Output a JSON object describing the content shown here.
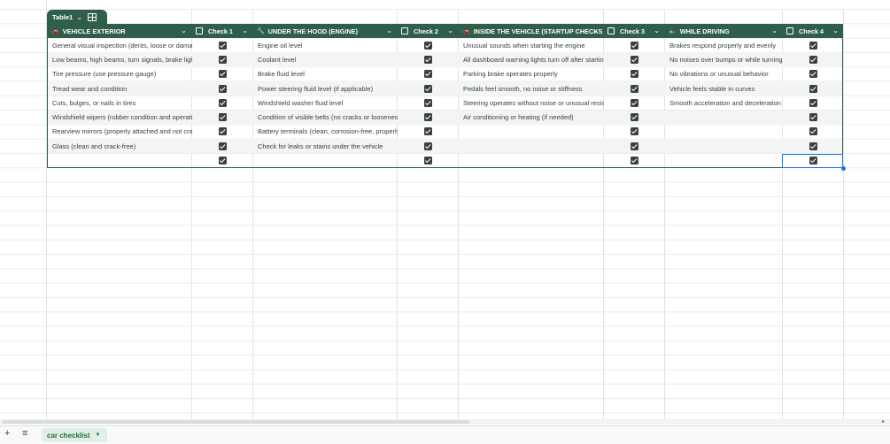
{
  "table": {
    "name": "Table1"
  },
  "columns": [
    {
      "label": "VEHICLE EXTERIOR",
      "icon": "car-icon",
      "icon_glyph": "🚗"
    },
    {
      "label": "Check 1",
      "icon": "checkbox-icon"
    },
    {
      "label": "UNDER THE HOOD (ENGINE)",
      "icon": "wrench-icon",
      "icon_glyph": "🔧"
    },
    {
      "label": "Check 2",
      "icon": "checkbox-icon"
    },
    {
      "label": "INSIDE THE VEHICLE (STARTUP CHECKS",
      "icon": "car-icon",
      "icon_glyph": "🚗"
    },
    {
      "label": "Check 3",
      "icon": "checkbox-icon"
    },
    {
      "label": "WHILE DRIVING",
      "icon": "speaker-icon",
      "icon_glyph": "🔈"
    },
    {
      "label": "Check 4",
      "icon": "checkbox-icon"
    }
  ],
  "rows": [
    {
      "ext": "General visual inspection (dents, loose or damage",
      "hood": "Engine oil level",
      "inside": "Unusual sounds when starting the engine",
      "driving": "Brakes respond properly and evenly"
    },
    {
      "ext": "Low beams, high beams, turn signals, brake lights",
      "hood": "Coolant level",
      "inside": "All dashboard warning lights turn off after starting",
      "driving": "No noises over bumps or while turning"
    },
    {
      "ext": "Tire pressure (use pressure gauge)",
      "hood": "Brake fluid level",
      "inside": "Parking brake operates properly",
      "driving": "No vibrations or unusual behavior"
    },
    {
      "ext": "Tread wear and condition",
      "hood": "Power steering fluid level (if applicable)",
      "inside": "Pedals feel smooth, no noise or stiffness",
      "driving": "Vehicle feels stable in curves"
    },
    {
      "ext": "Cuts, bulges, or nails in tires",
      "hood": "Windshield washer fluid level",
      "inside": "Steering operates without noise or unusual resista",
      "driving": "Smooth acceleration and deceleration"
    },
    {
      "ext": "Windshield wipers (rubber condition and operatio",
      "hood": "Condition of visible belts (no cracks or looseness)",
      "inside": "Air conditioning or heating (if needed)",
      "driving": ""
    },
    {
      "ext": "Rearview mirrors (properly attached and not crack",
      "hood": "Battery terminals (clean, corrosion-free, properly t",
      "inside": "",
      "driving": ""
    },
    {
      "ext": "Glass (clean and crack-free)",
      "hood": "Check for leaks or stains under the vehicle",
      "inside": "",
      "driving": ""
    },
    {
      "ext": "",
      "hood": "",
      "inside": "",
      "driving": ""
    }
  ],
  "sheet": {
    "tab_label": "car checklist"
  },
  "toolbar": {
    "add_label": "+",
    "list_label": "≡"
  },
  "colors": {
    "header": "#2f5f4a",
    "selection": "#1a73e8",
    "row_alt": "#f3f5f4"
  }
}
